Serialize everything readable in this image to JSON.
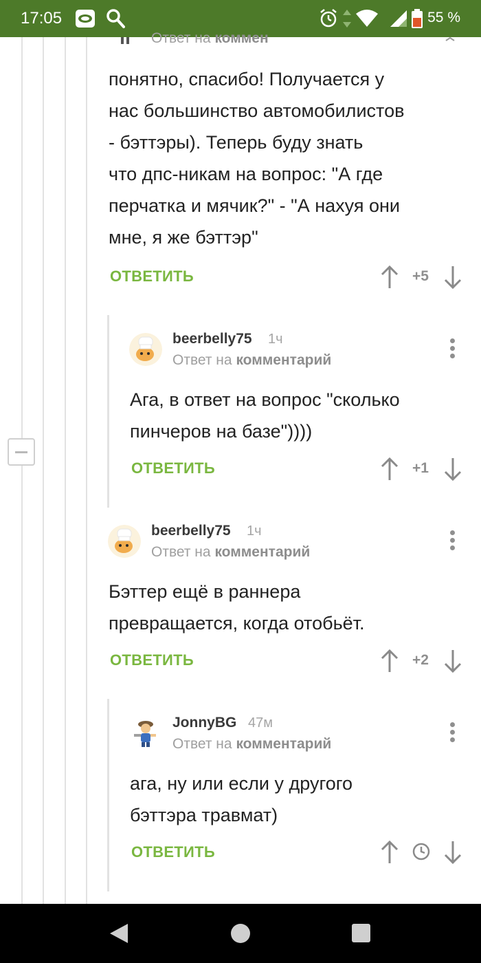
{
  "status_bar": {
    "time": "17:05",
    "battery_percent": "55 %",
    "icons": [
      "camera-app-icon",
      "search-icon",
      "alarm-icon",
      "data-arrows-icon",
      "wifi-icon",
      "signal-icon",
      "battery-icon"
    ]
  },
  "thread": {
    "partial_header": {
      "reply_prefix": "Ответ на",
      "reply_target": "комментарии"
    },
    "comments": [
      {
        "text_lines": [
          "понятно, спасибо! Получается у",
          "нас большинство автомобилистов",
          "- бэттэры). Теперь буду знать",
          "что дпс-никам на вопрос: \"А где",
          "перчатка и мячик?\" - \"А нахуя они",
          "мне, я же бэттэр\""
        ],
        "reply_label": "ОТВЕТИТЬ",
        "rating": "+5"
      },
      {
        "author": "beerbelly75",
        "age": "1ч",
        "reply_prefix": "Ответ на",
        "reply_target": "комментарий",
        "text_lines": [
          "Ага, в ответ на вопрос \"сколько",
          "пинчеров на базе\"))))"
        ],
        "reply_label": "ОТВЕТИТЬ",
        "rating": "+1"
      },
      {
        "author": "beerbelly75",
        "age": "1ч",
        "reply_prefix": "Ответ на",
        "reply_target": "комментарий",
        "text_lines": [
          "Бэттер ещё в раннера",
          "превращается, когда отобьёт."
        ],
        "reply_label": "ОТВЕТИТЬ",
        "rating": "+2"
      },
      {
        "author": "JonnyBG",
        "age": "47м",
        "reply_prefix": "Ответ на",
        "reply_target": "комментарий",
        "text_lines": [
          "ага, ну или если у другого",
          "бэттэра травмат)"
        ],
        "reply_label": "ОТВЕТИТЬ",
        "rating_icon": "clock-icon"
      }
    ]
  },
  "colors": {
    "status_bar_bg": "#4d7a29",
    "accent_green": "#7ab740",
    "nav_bar_bg": "#000000"
  }
}
